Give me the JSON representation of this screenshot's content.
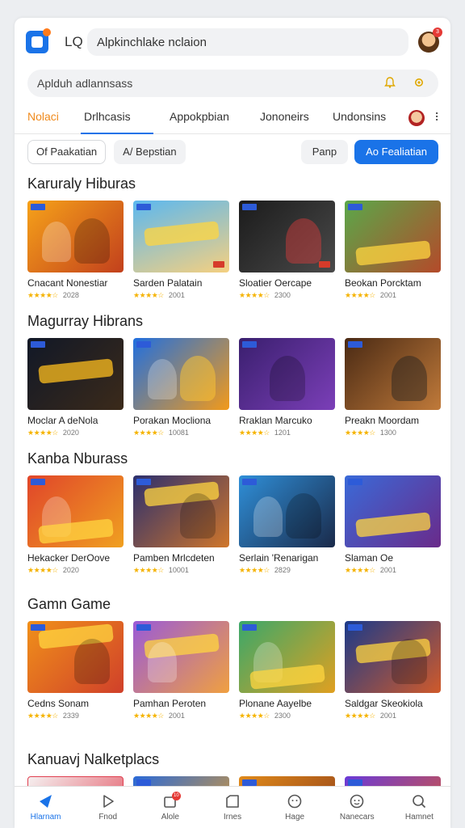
{
  "header": {
    "lq_label": "LQ",
    "search_text": "Alpkinchlake nclaion",
    "notification_count": "3"
  },
  "search": {
    "placeholder": "Aplduh adlannsass"
  },
  "tabs": [
    {
      "label": "Nolaci"
    },
    {
      "label": "Drlhcasis"
    },
    {
      "label": "Appokpbian"
    },
    {
      "label": "Jononeirs"
    },
    {
      "label": "Undonsins"
    }
  ],
  "tab_more": "⠇",
  "filters": {
    "chip1": "Of Paakatian",
    "chip2": "A/ Bepstian",
    "btn_light": "Panp",
    "btn_primary": "Ao Fealiatian"
  },
  "sections": [
    {
      "title": "Karuraly Hiburas",
      "items": [
        {
          "name": "Cnacant Nonestiar",
          "count": "2028"
        },
        {
          "name": "Sarden Palatain",
          "count": "2001"
        },
        {
          "name": "Sloatier Oercape",
          "count": "2300"
        },
        {
          "name": "Beokan Porcktam",
          "count": "2001"
        }
      ]
    },
    {
      "title": "Magurray Hibrans",
      "items": [
        {
          "name": "Moclar A deNola",
          "count": "2020"
        },
        {
          "name": "Porakan Mocliona",
          "count": "10081"
        },
        {
          "name": "Rraklan Marcuko",
          "count": "1201"
        },
        {
          "name": "Preakn Moordam",
          "count": "1300"
        }
      ]
    },
    {
      "title": "Kanba Nburass",
      "items": [
        {
          "name": "Hekacker DerOove",
          "count": "2020"
        },
        {
          "name": "Pamben Mrlcdeten",
          "count": "10001"
        },
        {
          "name": "Serlain 'Renarigan",
          "count": "2829"
        },
        {
          "name": "Slaman Oe",
          "count": "2001"
        }
      ]
    },
    {
      "title": "Gamn Game",
      "items": [
        {
          "name": "Cedns Sonam",
          "count": "2339"
        },
        {
          "name": "Pamhan Peroten",
          "count": "2001"
        },
        {
          "name": "Plonane Aayelbe",
          "count": "2300"
        },
        {
          "name": "Saldgar Skeokiola",
          "count": "2001"
        }
      ]
    },
    {
      "title": "Kanuavj Nalketplacs",
      "items": []
    }
  ],
  "nav": [
    {
      "label": "Hlarnam",
      "icon": "home-icon",
      "badge": ""
    },
    {
      "label": "Fnod",
      "icon": "play-icon",
      "badge": ""
    },
    {
      "label": "Alole",
      "icon": "apps-icon",
      "badge": "10"
    },
    {
      "label": "Irnes",
      "icon": "folder-icon",
      "badge": ""
    },
    {
      "label": "Hage",
      "icon": "face-icon",
      "badge": ""
    },
    {
      "label": "Nanecars",
      "icon": "smile-icon",
      "badge": ""
    },
    {
      "label": "Hamnet",
      "icon": "search-icon",
      "badge": ""
    }
  ],
  "colors": {
    "accent": "#1a73e8",
    "active_tab": "#f08a1c",
    "stars": "#f5b301",
    "badge": "#e53935"
  }
}
